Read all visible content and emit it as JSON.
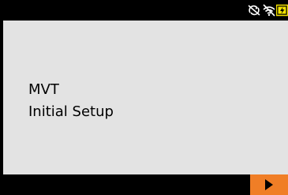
{
  "status_bar": {
    "icons": [
      "sync-disabled-icon",
      "wifi-off-icon",
      "battery-charging-icon"
    ],
    "battery_color": "#f4e200"
  },
  "main": {
    "line1": "MVT",
    "line2": "Initial Setup"
  },
  "bottom_bar": {
    "next_button_icon": "play-arrow-icon",
    "accent_color": "#f07e26"
  }
}
